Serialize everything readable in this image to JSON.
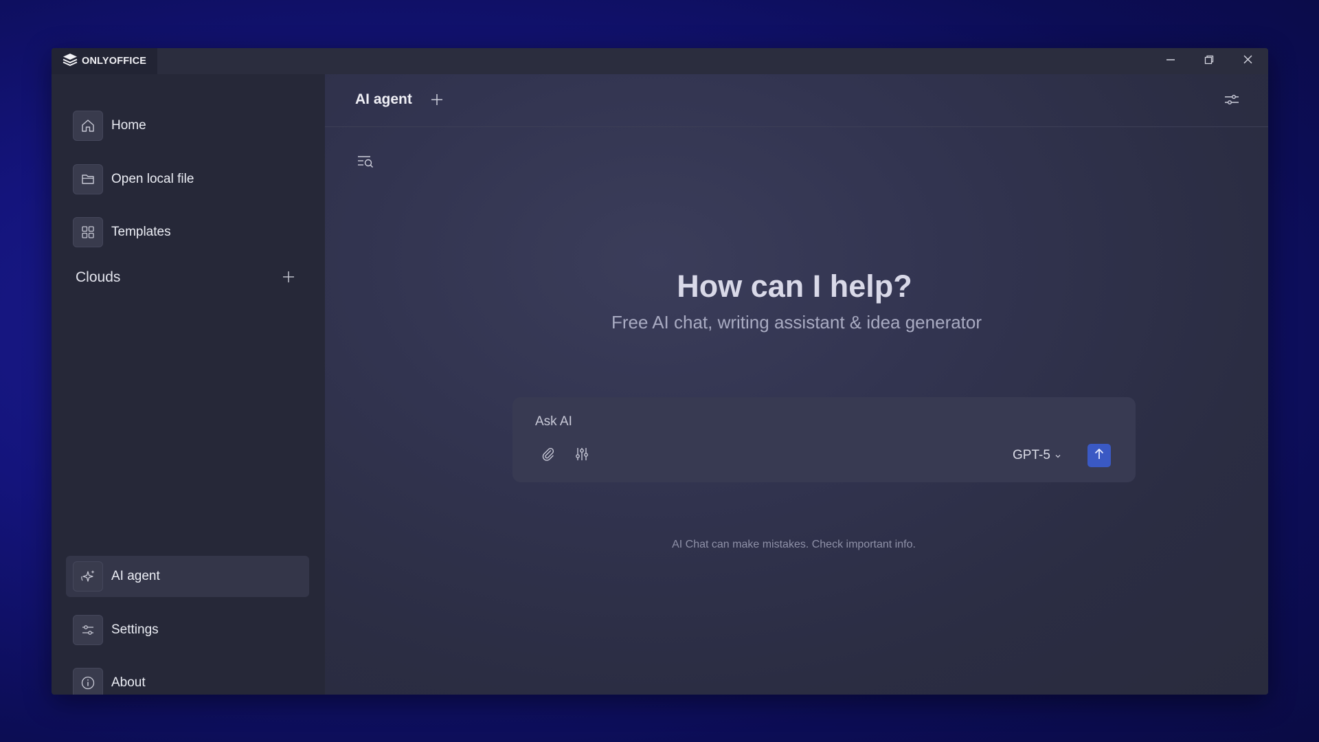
{
  "app": {
    "name": "ONLYOFFICE"
  },
  "window_controls": {
    "minimize": "minimize-icon",
    "restore": "restore-icon",
    "close": "close-icon"
  },
  "sidebar": {
    "top_items": [
      {
        "label": "Home",
        "icon": "home-icon"
      },
      {
        "label": "Open local file",
        "icon": "folder-icon"
      },
      {
        "label": "Templates",
        "icon": "grid-icon"
      }
    ],
    "clouds": {
      "label": "Clouds",
      "add_icon": "plus-icon"
    },
    "bottom_items": [
      {
        "label": "AI agent",
        "icon": "ai-sparkle-icon",
        "active": true
      },
      {
        "label": "Settings",
        "icon": "sliders-icon"
      },
      {
        "label": "About",
        "icon": "info-icon"
      }
    ]
  },
  "main": {
    "title": "AI agent",
    "hero_title": "How can I help?",
    "hero_subtitle": "Free AI chat, writing assistant & idea generator",
    "chat": {
      "placeholder": "Ask AI",
      "model": "GPT-5",
      "attach_icon": "paperclip-icon",
      "tune_icon": "tune-icon",
      "send_icon": "arrow-up-icon"
    },
    "disclaimer": "AI Chat can make mistakes. Check important info."
  },
  "colors": {
    "send_button": "#3a59c4",
    "sidebar_bg": "#262838",
    "active_item_bg": "#343649"
  }
}
